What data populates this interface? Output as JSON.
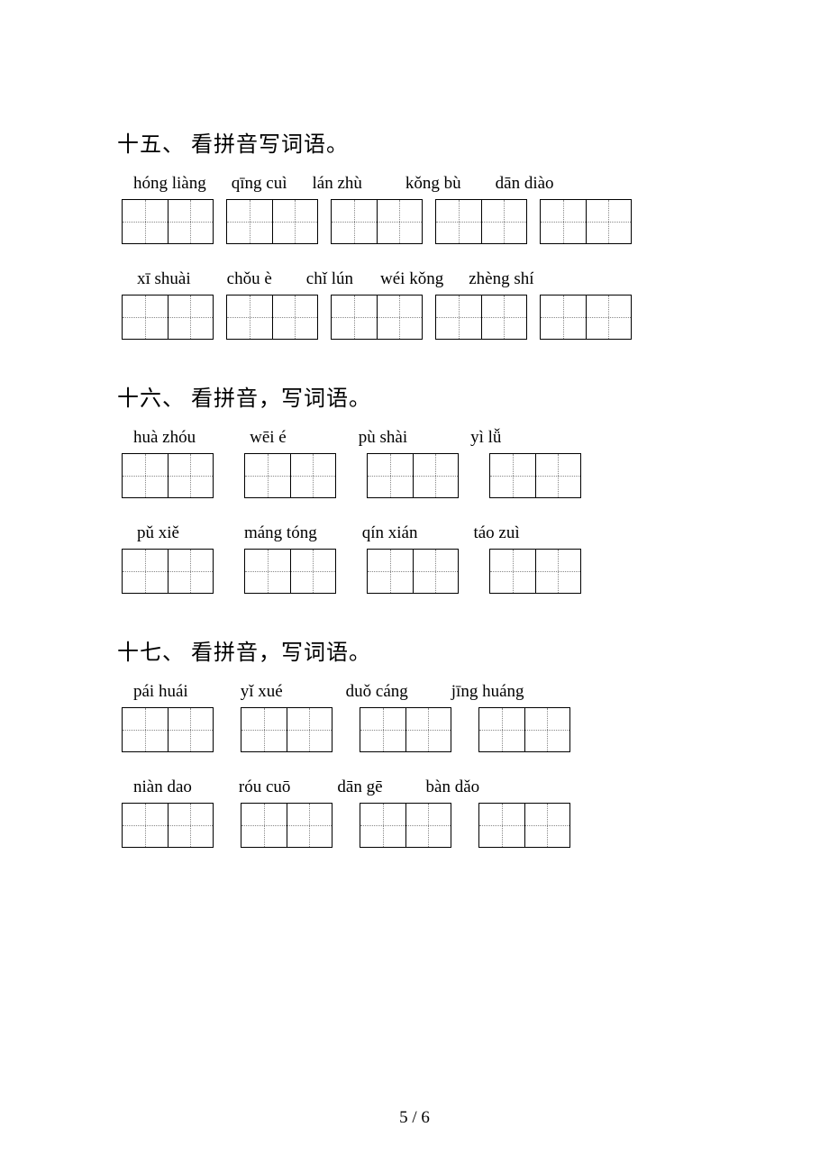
{
  "sections": [
    {
      "title": "十五、 看拼音写词语。",
      "rows": [
        {
          "pinyin": [
            "hóng liàng",
            "qīng cuì",
            "lán zhù",
            "kǒng bù",
            "dān diào"
          ],
          "boxes": 5
        },
        {
          "pinyin": [
            "xī shuài",
            "chǒu è",
            "chǐ lún",
            "wéi kǒng",
            "zhèng shí"
          ],
          "boxes": 5
        }
      ]
    },
    {
      "title": "十六、 看拼音，写词语。",
      "rows": [
        {
          "pinyin": [
            "huà zhóu",
            "wēi é",
            "pù shài",
            "yì lǚ"
          ],
          "boxes": 4
        },
        {
          "pinyin": [
            "pǔ xiě",
            "máng tóng",
            "qín xián",
            "táo zuì"
          ],
          "boxes": 4
        }
      ]
    },
    {
      "title": "十七、 看拼音，写词语。",
      "rows": [
        {
          "pinyin": [
            "pái huái",
            "yǐ xué",
            "duǒ cáng",
            "jīng huáng"
          ],
          "boxes": 4
        },
        {
          "pinyin": [
            "niàn dao",
            "róu cuō",
            "dān gē",
            "bàn dǎo"
          ],
          "boxes": 4
        }
      ]
    }
  ],
  "page_number": "5 / 6"
}
